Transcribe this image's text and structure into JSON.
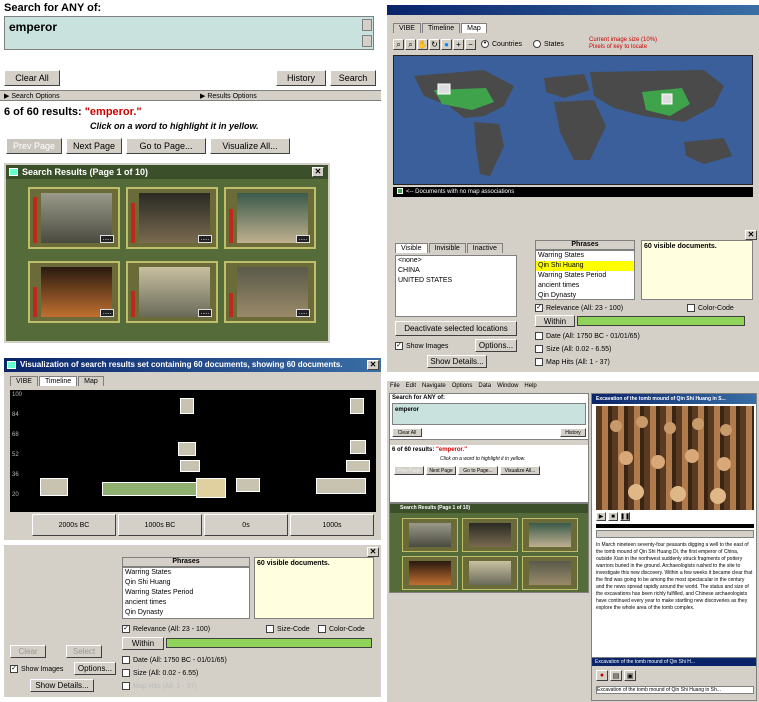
{
  "search_panel": {
    "title": "Search for ANY of:",
    "query": "emperor",
    "clear_all": "Clear All",
    "history": "History",
    "search": "Search",
    "search_options": "Search Options",
    "results_options": "Results Options",
    "results_count": "6 of 60 results:",
    "results_term": "\"emperor.\"",
    "click_hint": "Click on a word to highlight it in yellow.",
    "prev_page": "Prev Page",
    "next_page": "Next Page",
    "go_to_page": "Go to Page...",
    "visualize_all": "Visualize All..."
  },
  "results_window": {
    "title": "Search Results (Page 1 of 10)",
    "ellipsis": "....."
  },
  "map_window": {
    "tabs": [
      "VIBE",
      "Timeline",
      "Map"
    ],
    "countries": "Countries",
    "states": "States",
    "image_size_note": "Current image size (10%)",
    "keys_note": "Pixels of key to locate",
    "no_map": "<-- Documents with no map associations"
  },
  "locations_panel": {
    "tabs": [
      "Visible",
      "Invisible",
      "Inactive"
    ],
    "items": [
      "<none>",
      "CHINA",
      "UNITED STATES"
    ],
    "deactivate": "Deactivate selected locations",
    "show_images": "Show Images",
    "options": "Options...",
    "show_details": "Show Details..."
  },
  "phrases_panel": {
    "header": "Phrases",
    "items": [
      "Warring States",
      "Qin Shi Huang",
      "Warring States Period",
      "ancient times",
      "Qin Dynasty"
    ],
    "visible_docs": "60 visible documents.",
    "relevance": "Relevance (All: 23 - 100)",
    "size_code": "Size-Code",
    "color_code": "Color-Code",
    "within": "Within",
    "date": "Date (All: 1750 BC - 01/01/65)",
    "size": "Size (All: 0.02 - 6.55)",
    "map_hits": "Map Hits (All: 1 - 37)"
  },
  "timeline_window": {
    "title": "Visualization of search results set containing 60 documents, showing 60 documents.",
    "tabs": [
      "VIBE",
      "Timeline",
      "Map"
    ],
    "y_ticks": [
      "100",
      "84",
      "68",
      "52",
      "36",
      "20"
    ],
    "axis": [
      "2000s BC",
      "1000s BC",
      "0s",
      "1000s"
    ]
  },
  "timeline_controls": {
    "header": "Phrases",
    "items": [
      "Warring States",
      "Qin Shi Huang",
      "Warring States Period",
      "ancient times",
      "Qin Dynasty"
    ],
    "visible_docs": "60 visible documents.",
    "relevance": "Relevance (All: 23 - 100)",
    "size_code": "Size-Code",
    "color_code": "Color-Code",
    "within": "Within",
    "date": "Date (All: 1750 BC - 01/01/65)",
    "size": "Size (All: 0.02 - 6.55)",
    "map_hits": "Map Hits (All: 1 - 37)",
    "show_images": "Show Images",
    "options": "Options...",
    "show_details": "Show Details...",
    "clear": "Clear",
    "select": "Select"
  },
  "mini_app": {
    "menu": [
      "File",
      "Edit",
      "Navigate",
      "Options",
      "Data",
      "Window",
      "Help"
    ],
    "search_title": "Search for ANY of:",
    "query": "emperor",
    "clear_all": "Clear All",
    "history": "History",
    "results_count": "6 of 60 results:",
    "results_term": "\"emperor.\"",
    "click_hint": "Click on a word to highlight it in yellow.",
    "prev_page": "Prev Page",
    "next_page": "Next Page",
    "go_to_page": "Go to Page...",
    "visualize_all": "Visualize All...",
    "results_title": "Search Results (Page 1 of 10)",
    "excavation_title": "Excavation of the tomb mound of Qin Shi Huang in S...",
    "excavation_text": "In March nineteen seventy-four peasants digging a well to the east of the tomb mound of Qin Shi Huang Di, the first emperor of China, outside Xian in the northwest suddenly struck fragments of pottery warriors buried in the ground. Archaeologists rushed to the site to investigate this new discovery. Within a few weeks it became clear that the find was going to be among the most spectacular in the century and the news spread rapidly around the world. The status and size of the excavations has been richly fulfilled, and Chinese archaeologists have continued every year to make startling new discoveries as they explore the whole area of the tomb complex.",
    "bottom_title": "Excavation of the tomb mound of Qin Shi H...",
    "bottom_text": "Excavation of the tomb mound of Qin Shi Huang in Sh..."
  },
  "colors": {
    "highlight": "#ffff00",
    "relevance_bar": "#c0281c",
    "slider": "#8fd35a",
    "map_ocean": "#3a5f9a",
    "china": "#3ea34a"
  }
}
